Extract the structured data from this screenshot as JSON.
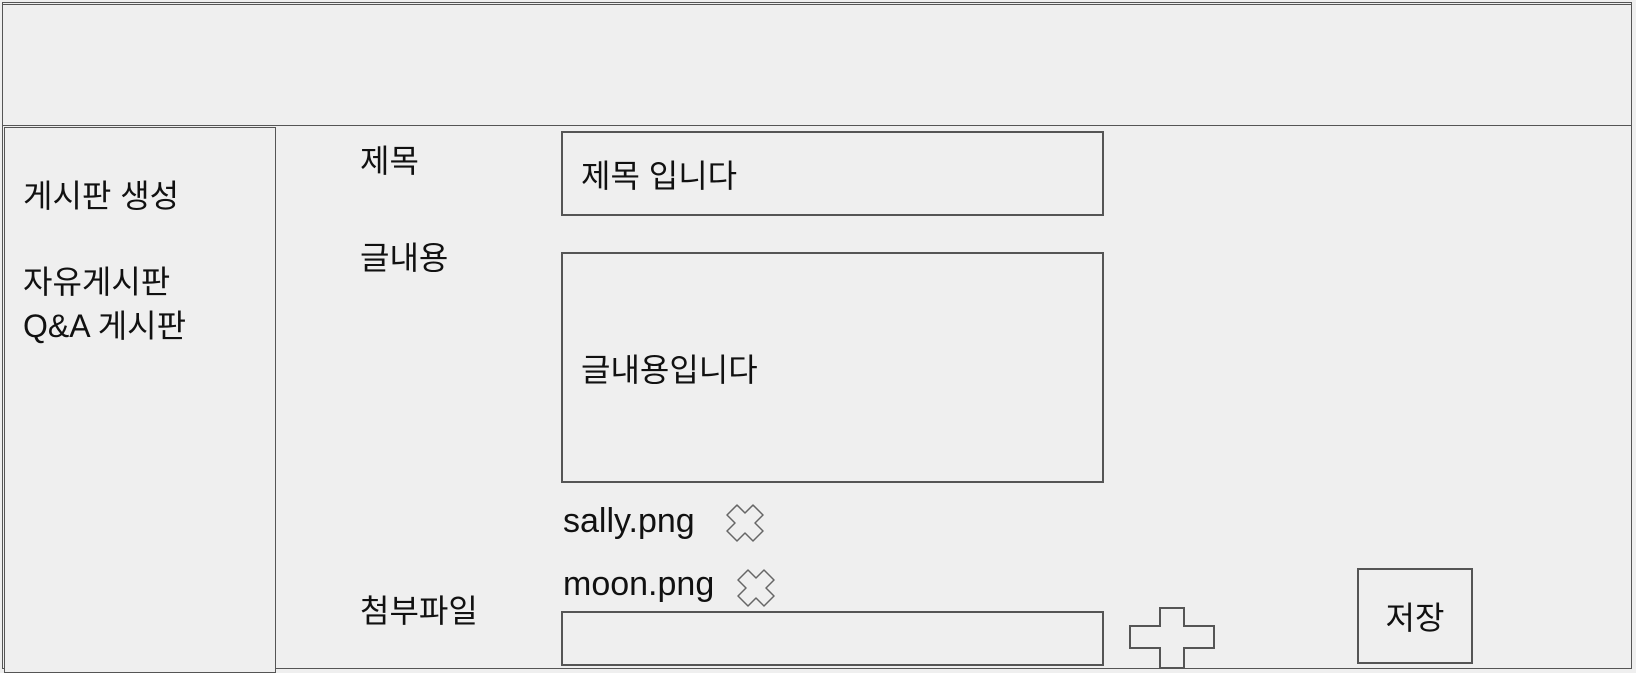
{
  "sidebar": {
    "items": [
      {
        "label": "게시판 생성"
      },
      {
        "label": "자유게시판"
      },
      {
        "label": "Q&A 게시판"
      }
    ]
  },
  "form": {
    "title_label": "제목",
    "title_value": "제목 입니다",
    "content_label": "글내용",
    "content_value": "글내용입니다",
    "attachment_label": "첨부파일",
    "attachments": [
      {
        "name": "sally.png",
        "remove_icon": "close-x-icon"
      },
      {
        "name": "moon.png",
        "remove_icon": "close-x-icon"
      }
    ],
    "attachment_value": "",
    "add_icon": "plus-icon",
    "save_label": "저장"
  },
  "colors": {
    "background": "#efefef",
    "border": "#555555",
    "text": "#111111"
  }
}
